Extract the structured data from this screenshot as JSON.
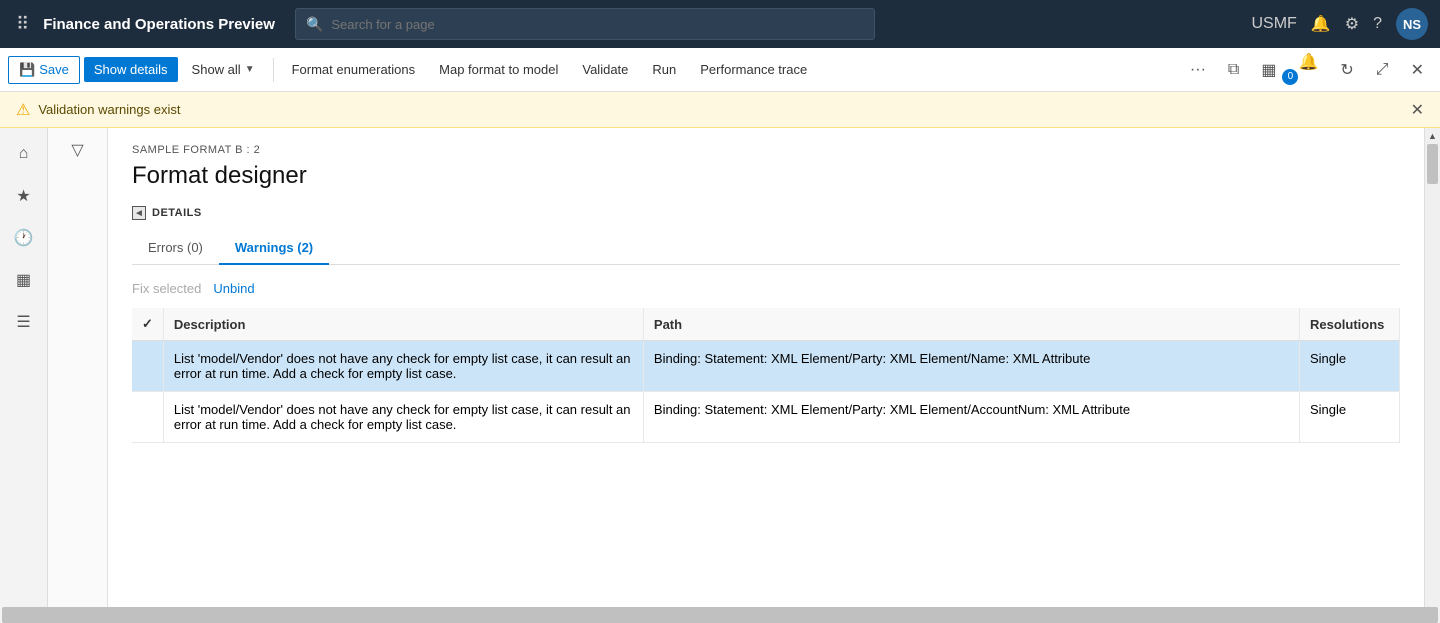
{
  "app": {
    "title": "Finance and Operations Preview",
    "user_initials": "NS",
    "user_company": "USMF"
  },
  "search": {
    "placeholder": "Search for a page"
  },
  "toolbar": {
    "save_label": "Save",
    "show_details_label": "Show details",
    "show_all_label": "Show all",
    "format_enumerations_label": "Format enumerations",
    "map_format_label": "Map format to model",
    "validate_label": "Validate",
    "run_label": "Run",
    "performance_trace_label": "Performance trace"
  },
  "warning_bar": {
    "message": "Validation warnings exist"
  },
  "content": {
    "breadcrumb": "SAMPLE FORMAT B : 2",
    "page_title": "Format designer",
    "details_section_label": "DETAILS",
    "tabs": [
      {
        "label": "Errors (0)",
        "active": false
      },
      {
        "label": "Warnings (2)",
        "active": true
      }
    ],
    "actions": {
      "fix_selected": "Fix selected",
      "unbind": "Unbind"
    },
    "table": {
      "columns": [
        {
          "label": ""
        },
        {
          "label": "Description"
        },
        {
          "label": "Path"
        },
        {
          "label": "Resolutions"
        }
      ],
      "rows": [
        {
          "selected": true,
          "description": "List 'model/Vendor' does not have any check for empty list case, it can result an error at run time. Add a check for empty list case.",
          "path": "Binding: Statement: XML Element/Party: XML Element/Name: XML Attribute",
          "resolutions": "Single"
        },
        {
          "selected": false,
          "description": "List 'model/Vendor' does not have any check for empty list case, it can result an error at run time. Add a check for empty list case.",
          "path": "Binding: Statement: XML Element/Party: XML Element/AccountNum: XML Attribute",
          "resolutions": "Single"
        }
      ]
    }
  }
}
